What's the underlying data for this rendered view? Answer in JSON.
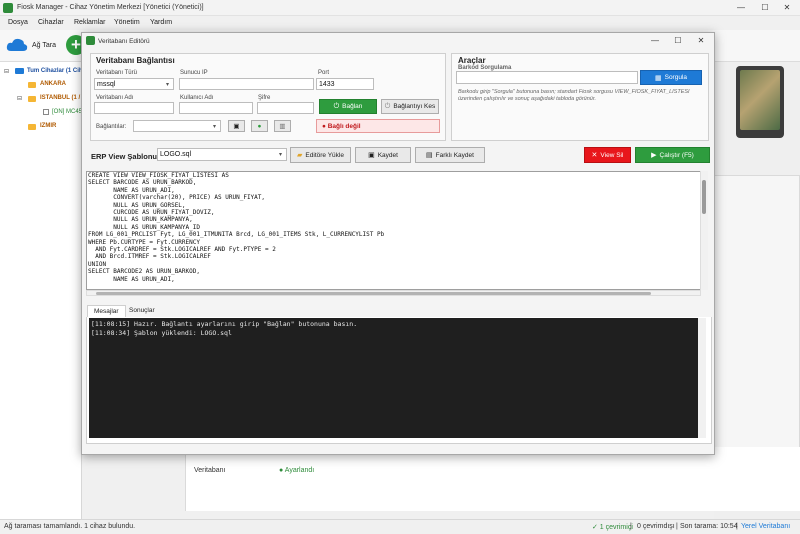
{
  "main": {
    "title": "Fiosk Manager - Cihaz Yönetim Merkezi [Yönetici (Yönetici)]",
    "menu": [
      "Dosya",
      "Cihazlar",
      "Reklamlar",
      "Yönetim",
      "Yardım"
    ],
    "toolbar": {
      "scan_label": "Ağ Tara",
      "add_label": "+"
    },
    "window_controls": [
      "—",
      "☐",
      "✕"
    ]
  },
  "tree": {
    "root": "Tum Cihazlar (1 Cihaz)",
    "items": [
      {
        "label": "ANKARA"
      },
      {
        "label": "ISTANBUL (1 / 1)"
      },
      {
        "label": "[ON] MC45..."
      },
      {
        "label": "IZMIR"
      }
    ]
  },
  "detail": {
    "db_label": "Veritabanı",
    "db_value": "● Ayarlandı"
  },
  "status": {
    "left": "Ağ taraması tamamlandı. 1 cihaz bulundu.",
    "online": "✓ 1 çevrimiçi",
    "offline": "0 çevrimdışı",
    "last_scan": "Son tarama: 10:54",
    "db": "Yerel Veritabanı",
    "sep": "|"
  },
  "dialog": {
    "title": "Veritabanı Editörü",
    "window_controls": [
      "—",
      "☐",
      "✕"
    ],
    "connection": {
      "title": "Veritabanı Bağlantısı",
      "db_type_label": "Veritabanı Türü",
      "db_type_value": "mssql",
      "server_label": "Sunucu IP",
      "server_value": "",
      "port_label": "Port",
      "port_value": "1433",
      "db_name_label": "Veritabanı Adı",
      "db_name_value": "",
      "user_label": "Kullanıcı Adı",
      "user_value": "",
      "password_label": "Şifre",
      "password_value": "",
      "connect_label": "Bağlan",
      "disconnect_label": "Bağlantıyı Kes",
      "connections_label": "Bağlantılar:",
      "status_text": "● Bağlı değil"
    },
    "tools": {
      "title": "Araçlar",
      "barcode_label": "Barkod Sorgulama",
      "barcode_value": "",
      "query_label": "Sorgula",
      "help_line1": "Barkodu girip \"Sorgula\" butonuna basın; standart Fiosk sorgusu VIEW_FIOSK_FIYAT_LISTESI",
      "help_line2": "üzerinden çalıştırılır ve sonuç aşağıdaki tabloda görünür."
    },
    "erp": {
      "label": "ERP View Şablonu:",
      "template_value": "LOGO.sql",
      "load_label": "Editöre Yükle",
      "save_label": "Kaydet",
      "save_as_label": "Farklı Kaydet",
      "drop_view_label": "View Sil",
      "run_label": "Çalıştır (F5)"
    },
    "sql_lines": [
      "CREATE VIEW VIEW_FIOSK_FIYAT_LISTESI AS",
      "SELECT BARCODE AS URUN_BARKOD,",
      "       NAME AS URUN_ADI,",
      "       CONVERT(varchar(20), PRICE) AS URUN_FIYAT,",
      "       NULL AS URUN_GORSEL,",
      "       CURCODE AS URUN_FIYAT_DOVIZ,",
      "       NULL AS URUN_KAMPANYA,",
      "       NULL AS URUN_KAMPANYA_ID",
      "FROM LG_001_PRCLIST Fyt, LG_001_ITMUNITA Brcd, LG_001_ITEMS Stk, L_CURRENCYLIST Pb",
      "WHERE Pb.CURTYPE = Fyt.CURRENCY",
      "  AND Fyt.CARDREF = Stk.LOGICALREF AND Fyt.PTYPE = 2",
      "  AND Brcd.ITMREF = Stk.LOGICALREF",
      "UNION",
      "SELECT BARCODE2 AS URUN_BARKOD,",
      "       NAME AS URUN_ADI,"
    ],
    "tabs": [
      "Mesajlar",
      "Sonuçlar"
    ],
    "messages": [
      "[11:08:15] Hazır. Bağlantı ayarlarını girip \"Bağlan\" butonuna basın.",
      "[11:08:34] Şablon yüklendi: LOGO.sql"
    ]
  },
  "colors": {
    "accent_green": "#2e8b3a",
    "connect_green": "#2e9c3e",
    "query_blue": "#1e7ad6",
    "drop_red": "#e8161b",
    "status_red_bg": "#fde7e7"
  }
}
